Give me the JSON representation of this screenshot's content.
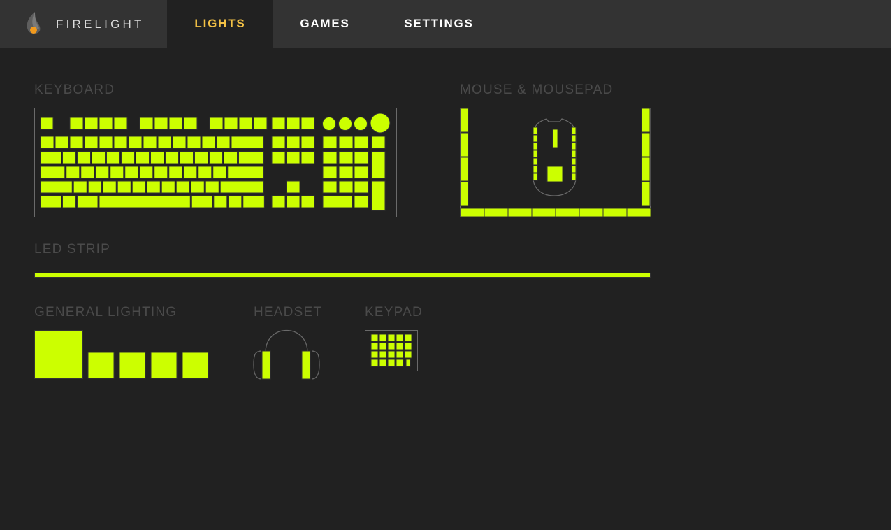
{
  "app": {
    "name": "FIRELIGHT",
    "logo_icon": "flame-icon"
  },
  "nav": {
    "tabs": [
      {
        "label": "LIGHTS",
        "active": true
      },
      {
        "label": "GAMES",
        "active": false
      },
      {
        "label": "SETTINGS",
        "active": false
      }
    ]
  },
  "sections": {
    "keyboard": "KEYBOARD",
    "mouse": "MOUSE & MOUSEPAD",
    "led_strip": "LED STRIP",
    "general": "GENERAL LIGHTING",
    "headset": "HEADSET",
    "keypad": "KEYPAD"
  },
  "colors": {
    "led": "#ccff00",
    "active_tab": "#f3c145",
    "background": "#212121",
    "nav_background": "#333333",
    "section_title": "#4a4a4a"
  }
}
